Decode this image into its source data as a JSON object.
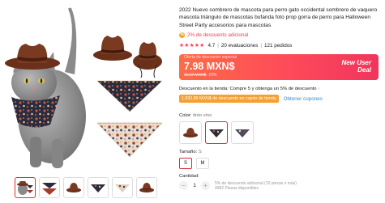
{
  "product": {
    "title": "2022 Nuevo sombrero de mascota para perro gato occidental sombrero de vaquero mascota triángulo de mascotas bufanda foto prop gorra de perro para Halloween Street Party accesorios para mascotas",
    "discount_badge_text": "2% de descuento adicional",
    "rating_stars": "★★★★★",
    "rating_value": "4.7",
    "reviews": "20 evaluaciones",
    "orders": "121 pedidos"
  },
  "price": {
    "tag": "Oferta de descuento especial",
    "current": "7.98 MXN$",
    "original": "11,17 MXN$",
    "discount_percent": "-29%",
    "promo": "New User Deal"
  },
  "store": {
    "promo_text": "Descuento en la tienda: Compre 5 y obtenga un 5% de descuento",
    "coupon": "1.993,89 MXN$ de descuento en cupón de tienda",
    "coupon_link": "Obtener cupones"
  },
  "options": {
    "color_label": "Color:",
    "color_value": "tinto vino",
    "size_label": "Tamaño:",
    "size_value": "S",
    "sizes": [
      "S",
      "M"
    ],
    "quantity_label": "Cantidad:",
    "quantity": "1",
    "minus": "−",
    "plus": "+",
    "quantity_info_1": "5% de descuento adicional (10 piezas o más)",
    "quantity_info_2": "4982 Piezas disponibles"
  },
  "colors": {
    "accent": "#fd384f",
    "hat_brown": "#7a3a22",
    "link": "#2e8bd6",
    "coupon": "#f4a032"
  },
  "icons": {
    "discount": "discount-dot-icon",
    "thumbs": [
      "cat-hat-thumb",
      "scarf-set-thumb",
      "hat-thumb",
      "scarf-thumb",
      "scarf-thumb",
      "hat-thumb"
    ]
  }
}
